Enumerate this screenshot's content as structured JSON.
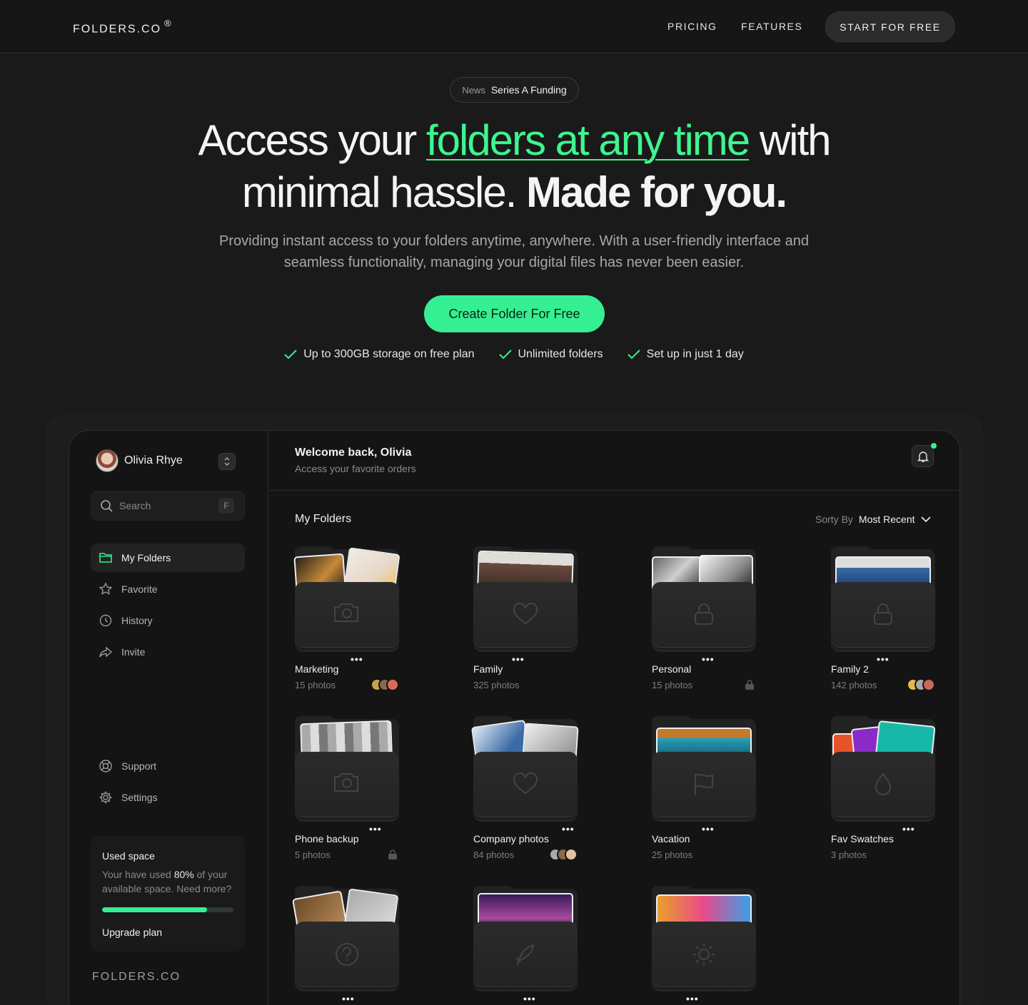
{
  "nav": {
    "logo": "FOLDERS.CO",
    "logo_mark": "®",
    "links": [
      "PRICING",
      "FEATURES"
    ],
    "cta": "START FOR FREE"
  },
  "hero": {
    "news_tag": "News",
    "news_text": "Series A Funding",
    "headline_pre": "Access your ",
    "headline_highlight": "folders at any time",
    "headline_post": " with",
    "headline_line2": "minimal hassle. ",
    "headline_bold": "Made for you.",
    "subtext": "Providing instant access to your folders anytime, anywhere. With a user-friendly interface and seamless functionality, managing your digital files has never been easier.",
    "cta": "Create Folder For Free",
    "checks": [
      "Up to 300GB storage on free plan",
      "Unlimited folders",
      "Set up in just 1 day"
    ]
  },
  "app": {
    "user_name": "Olivia Rhye",
    "search_placeholder": "Search",
    "search_shortcut": "F",
    "nav_items": [
      {
        "label": "My Folders",
        "icon": "folder-icon"
      },
      {
        "label": "Favorite",
        "icon": "star-icon"
      },
      {
        "label": "History",
        "icon": "history-icon"
      },
      {
        "label": "Invite",
        "icon": "share-icon"
      }
    ],
    "bottom_items": [
      {
        "label": "Support",
        "icon": "support-icon"
      },
      {
        "label": "Settings",
        "icon": "gear-icon"
      }
    ],
    "usage": {
      "title": "Used space",
      "text_pre": "Your have used ",
      "percent_text": "80%",
      "text_post": " of your available space. Need more?",
      "percent": 0.8,
      "upgrade": "Upgrade plan"
    },
    "footer_logo": "FOLDERS.CO",
    "welcome": "Welcome back, Olivia",
    "welcome_sub": "Access your favorite orders",
    "section_title": "My Folders",
    "sort_label": "Sorty By",
    "sort_value": "Most Recent",
    "folders": [
      {
        "name": "Marketing",
        "count": "15 photos",
        "icon": "camera-icon"
      },
      {
        "name": "Family",
        "count": "325 photos",
        "icon": "heart-icon"
      },
      {
        "name": "Personal",
        "count": "15 photos",
        "icon": "lock-icon"
      },
      {
        "name": "Family 2",
        "count": "142 photos",
        "icon": "lock-icon"
      },
      {
        "name": "Phone backup",
        "count": "5 photos",
        "icon": "camera-icon"
      },
      {
        "name": "Company photos",
        "count": "84 photos",
        "icon": "heart-icon"
      },
      {
        "name": "Vacation",
        "count": "25 photos",
        "icon": "flag-icon"
      },
      {
        "name": "Fav Swatches",
        "count": "3 photos",
        "icon": "drop-icon"
      },
      {
        "name": "",
        "count": "",
        "icon": "question-icon"
      },
      {
        "name": "",
        "count": "",
        "icon": "rocket-icon"
      },
      {
        "name": "",
        "count": "",
        "icon": "sun-icon"
      }
    ],
    "colors": {
      "accent": "#35f092",
      "background": "#171717",
      "panel": "#141414"
    }
  }
}
